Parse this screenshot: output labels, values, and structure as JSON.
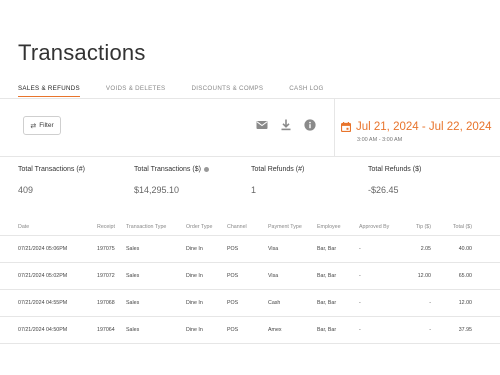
{
  "page": {
    "title": "Transactions"
  },
  "tabs": [
    {
      "label": "SALES & REFUNDS"
    },
    {
      "label": "VOIDS & DELETES"
    },
    {
      "label": "DISCOUNTS & COMPS"
    },
    {
      "label": "CASH LOG"
    }
  ],
  "toolbar": {
    "filter_label": "Filter",
    "icons": [
      "mail-icon",
      "download-icon",
      "info-icon"
    ]
  },
  "date_filter": {
    "range": "Jul 21, 2024 - Jul 22, 2024",
    "time": "3:00 AM - 3:00 AM"
  },
  "summary": [
    {
      "label": "Total Transactions (#)",
      "value": "409"
    },
    {
      "label": "Total Transactions ($)",
      "value": "$14,295.10"
    },
    {
      "label": "Total Refunds (#)",
      "value": "1"
    },
    {
      "label": "Total Refunds ($)",
      "value": "-$26.45"
    }
  ],
  "table": {
    "columns": [
      "Date",
      "Receipt",
      "Transaction Type",
      "Order Type",
      "Channel",
      "Payment Type",
      "Employee",
      "Approved By",
      "Tip ($)",
      "Total ($)"
    ],
    "rows": [
      [
        "07/21/2024 05:06PM",
        "197075",
        "Sales",
        "Dine In",
        "POS",
        "Visa",
        "Bar, Bar",
        "-",
        "2.05",
        "40.00"
      ],
      [
        "07/21/2024 05:02PM",
        "197072",
        "Sales",
        "Dine In",
        "POS",
        "Visa",
        "Bar, Bar",
        "-",
        "12.00",
        "65.00"
      ],
      [
        "07/21/2024 04:55PM",
        "197068",
        "Sales",
        "Dine In",
        "POS",
        "Cash",
        "Bar, Bar",
        "-",
        "-",
        "12.00"
      ],
      [
        "07/21/2024 04:50PM",
        "197064",
        "Sales",
        "Dine In",
        "POS",
        "Amex",
        "Bar, Bar",
        "-",
        "-",
        "37.95"
      ]
    ]
  },
  "colors": {
    "accent": "#e8742c",
    "text": "#333333",
    "muted": "#888888",
    "rule": "#e6e6e6"
  }
}
